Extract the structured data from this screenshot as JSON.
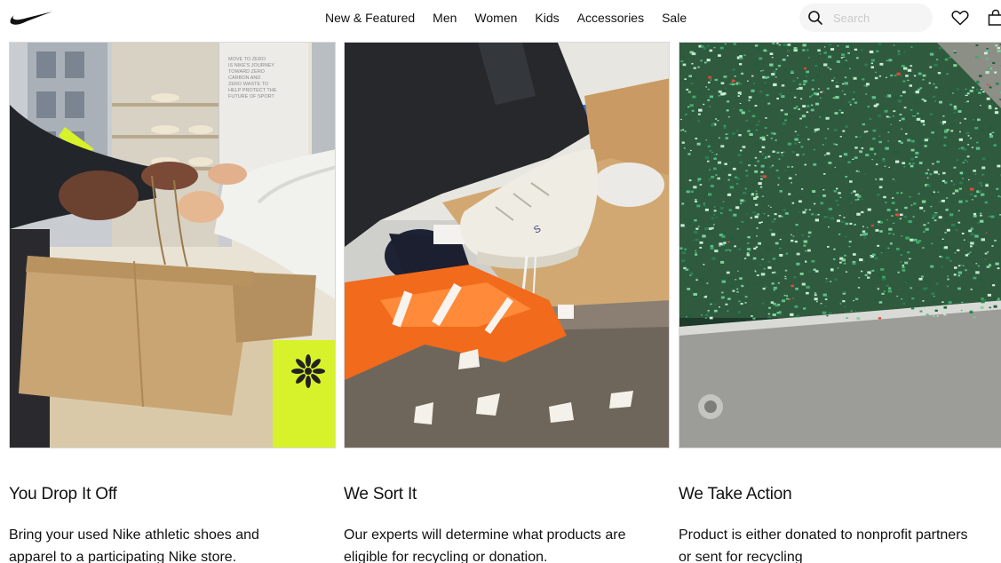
{
  "header": {
    "logo": "nike-swoosh-logo",
    "nav": [
      "New & Featured",
      "Men",
      "Women",
      "Kids",
      "Accessories",
      "Sale"
    ],
    "search": {
      "placeholder": "Search",
      "value": ""
    },
    "icons": [
      "search-icon",
      "heart-icon",
      "bag-icon"
    ]
  },
  "steps": [
    {
      "title": "You Drop It Off",
      "text": "Bring your used Nike athletic shoes and\napparel to a participating Nike store.",
      "image_text": "MOVE TO ZERO\nIS NIKE'S JOURNEY\nTOWARD ZERO\nCARBON AND\nZERO WASTE TO\nHELP PROTECT THE\nFUTURE OF SPORT"
    },
    {
      "title": "We Sort It",
      "text": "Our experts will determine what products are\neligible for recycling or donation."
    },
    {
      "title": "We Take Action",
      "text": "Product is either donated to nonprofit partners\nor sent for recycling"
    }
  ],
  "colors": {
    "text": "#111111",
    "search_bg": "#f5f5f5",
    "accent_yellow": "#d7f22a",
    "tape_orange": "#f26a1b",
    "grind_green": "#3fa86a"
  }
}
